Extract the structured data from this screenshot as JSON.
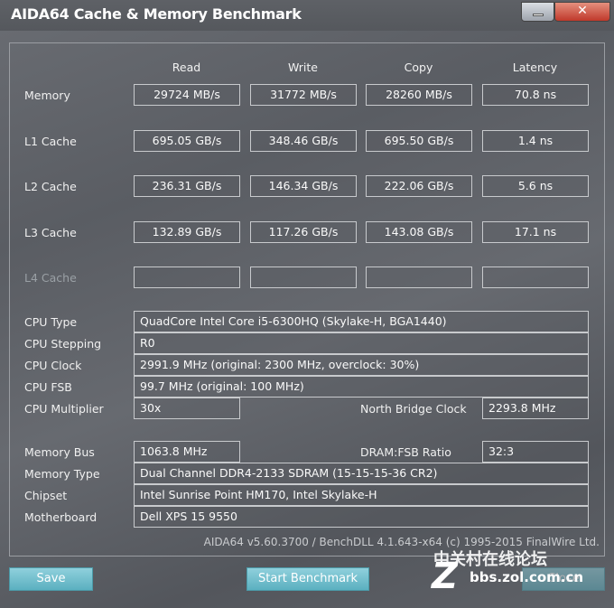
{
  "window": {
    "title": "AIDA64 Cache & Memory Benchmark"
  },
  "columns": [
    "Read",
    "Write",
    "Copy",
    "Latency"
  ],
  "rows": [
    {
      "label": "Memory",
      "values": [
        "29724 MB/s",
        "31772 MB/s",
        "28260 MB/s",
        "70.8 ns"
      ]
    },
    {
      "label": "L1 Cache",
      "values": [
        "695.05 GB/s",
        "348.46 GB/s",
        "695.50 GB/s",
        "1.4 ns"
      ]
    },
    {
      "label": "L2 Cache",
      "values": [
        "236.31 GB/s",
        "146.34 GB/s",
        "222.06 GB/s",
        "5.6 ns"
      ]
    },
    {
      "label": "L3 Cache",
      "values": [
        "132.89 GB/s",
        "117.26 GB/s",
        "143.08 GB/s",
        "17.1 ns"
      ]
    },
    {
      "label": "L4 Cache",
      "values": [
        "",
        "",
        "",
        ""
      ]
    }
  ],
  "info": {
    "cpu_type": {
      "label": "CPU Type",
      "value": "QuadCore Intel Core i5-6300HQ  (Skylake-H, BGA1440)"
    },
    "cpu_stepping": {
      "label": "CPU Stepping",
      "value": "R0"
    },
    "cpu_clock": {
      "label": "CPU Clock",
      "value": "2991.9 MHz  (original: 2300 MHz, overclock: 30%)"
    },
    "cpu_fsb": {
      "label": "CPU FSB",
      "value": "99.7 MHz  (original: 100 MHz)"
    },
    "cpu_multiplier": {
      "label": "CPU Multiplier",
      "value": "30x"
    },
    "nb_clock": {
      "label": "North Bridge Clock",
      "value": "2293.8 MHz"
    },
    "memory_bus": {
      "label": "Memory Bus",
      "value": "1063.8 MHz"
    },
    "dram_ratio": {
      "label": "DRAM:FSB Ratio",
      "value": "32:3"
    },
    "memory_type": {
      "label": "Memory Type",
      "value": "Dual Channel DDR4-2133 SDRAM  (15-15-15-36 CR2)"
    },
    "chipset": {
      "label": "Chipset",
      "value": "Intel Sunrise Point HM170, Intel Skylake-H"
    },
    "motherboard": {
      "label": "Motherboard",
      "value": "Dell XPS 15 9550"
    }
  },
  "footer": "AIDA64 v5.60.3700 / BenchDLL 4.1.643-x64  (c) 1995-2015 FinalWire Ltd.",
  "buttons": {
    "save": "Save",
    "start": "Start Benchmark",
    "close": "Close"
  },
  "watermark": {
    "line1": "中关村在线论坛",
    "line2": "bbs.zol.com.cn"
  }
}
